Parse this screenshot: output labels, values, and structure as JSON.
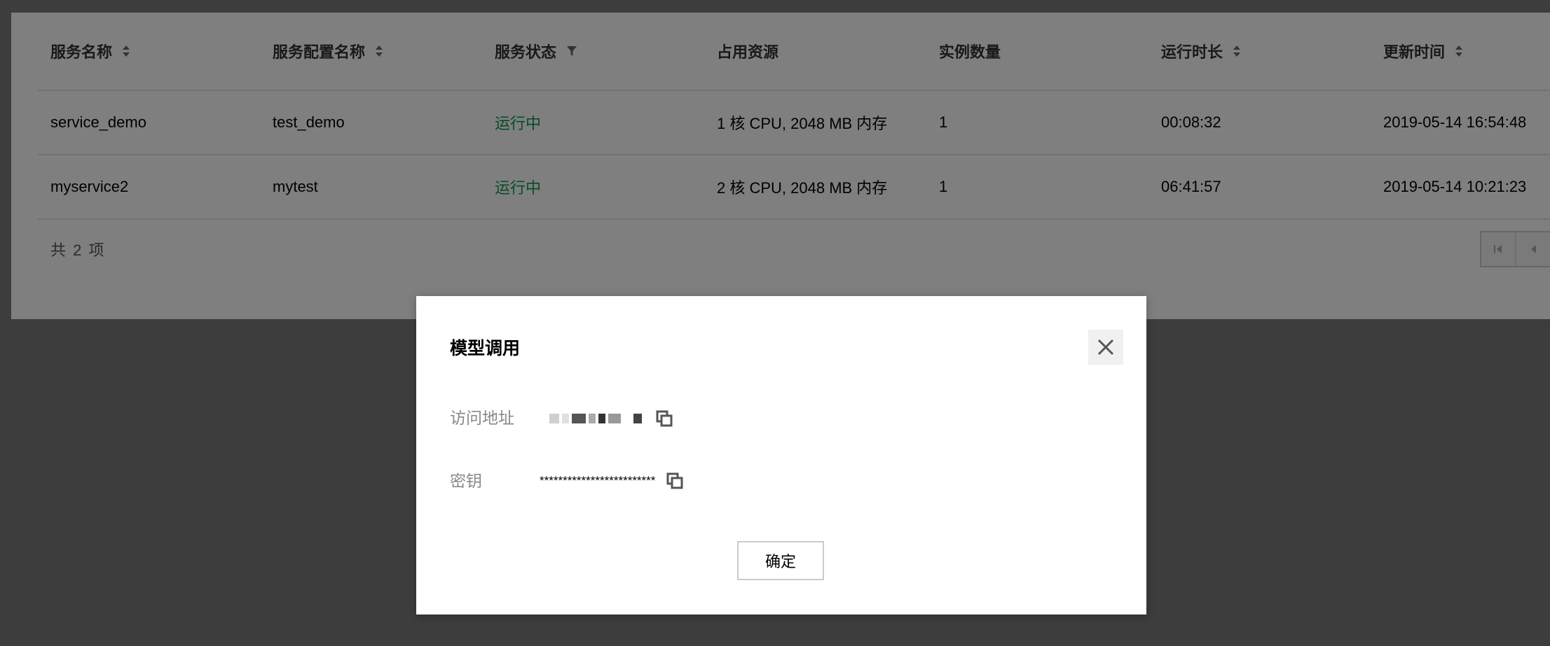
{
  "table": {
    "columns": [
      {
        "label": "服务名称"
      },
      {
        "label": "服务配置名称"
      },
      {
        "label": "服务状态"
      },
      {
        "label": "占用资源"
      },
      {
        "label": "实例数量"
      },
      {
        "label": "运行时长"
      },
      {
        "label": "更新时间"
      }
    ],
    "rows": [
      {
        "name": "service_demo",
        "config": "test_demo",
        "status": "运行中",
        "resources": "1 核 CPU, 2048 MB 内存",
        "instances": "1",
        "runtime": "00:08:32",
        "updated": "2019-05-14 16:54:48"
      },
      {
        "name": "myservice2",
        "config": "mytest",
        "status": "运行中",
        "resources": "2 核 CPU, 2048 MB 内存",
        "instances": "1",
        "runtime": "06:41:57",
        "updated": "2019-05-14 10:21:23"
      }
    ],
    "footer": "共 2 项"
  },
  "modal": {
    "title": "模型调用",
    "access_label": "访问地址",
    "key_label": "密钥",
    "key_value": "*************************",
    "ok_label": "确定"
  },
  "colors": {
    "status_running": "#0a9b46"
  }
}
